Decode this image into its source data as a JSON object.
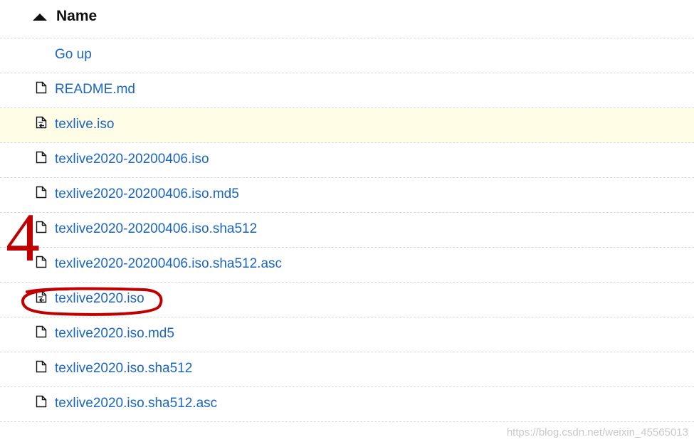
{
  "header": {
    "column_name": "Name",
    "sort_direction": "ascending"
  },
  "rows": [
    {
      "label": "Go up",
      "icon": "none",
      "highlighted": false
    },
    {
      "label": "README.md",
      "icon": "file-icon",
      "highlighted": false
    },
    {
      "label": "texlive.iso",
      "icon": "symlink-file-icon",
      "highlighted": true
    },
    {
      "label": "texlive2020-20200406.iso",
      "icon": "file-icon",
      "highlighted": false
    },
    {
      "label": "texlive2020-20200406.iso.md5",
      "icon": "file-icon",
      "highlighted": false
    },
    {
      "label": "texlive2020-20200406.iso.sha512",
      "icon": "file-icon",
      "highlighted": false
    },
    {
      "label": "texlive2020-20200406.iso.sha512.asc",
      "icon": "file-icon",
      "highlighted": false
    },
    {
      "label": "texlive2020.iso",
      "icon": "symlink-file-icon",
      "highlighted": false
    },
    {
      "label": "texlive2020.iso.md5",
      "icon": "file-icon",
      "highlighted": false
    },
    {
      "label": "texlive2020.iso.sha512",
      "icon": "file-icon",
      "highlighted": false
    },
    {
      "label": "texlive2020.iso.sha512.asc",
      "icon": "file-icon",
      "highlighted": false
    }
  ],
  "annotation": {
    "step_number": "4",
    "color": "#c00000"
  },
  "watermark": "https://blog.csdn.net/weixin_45565013",
  "colors": {
    "link": "#1a66c2",
    "highlight_row": "#fffde6",
    "divider": "#d8d8d8"
  }
}
